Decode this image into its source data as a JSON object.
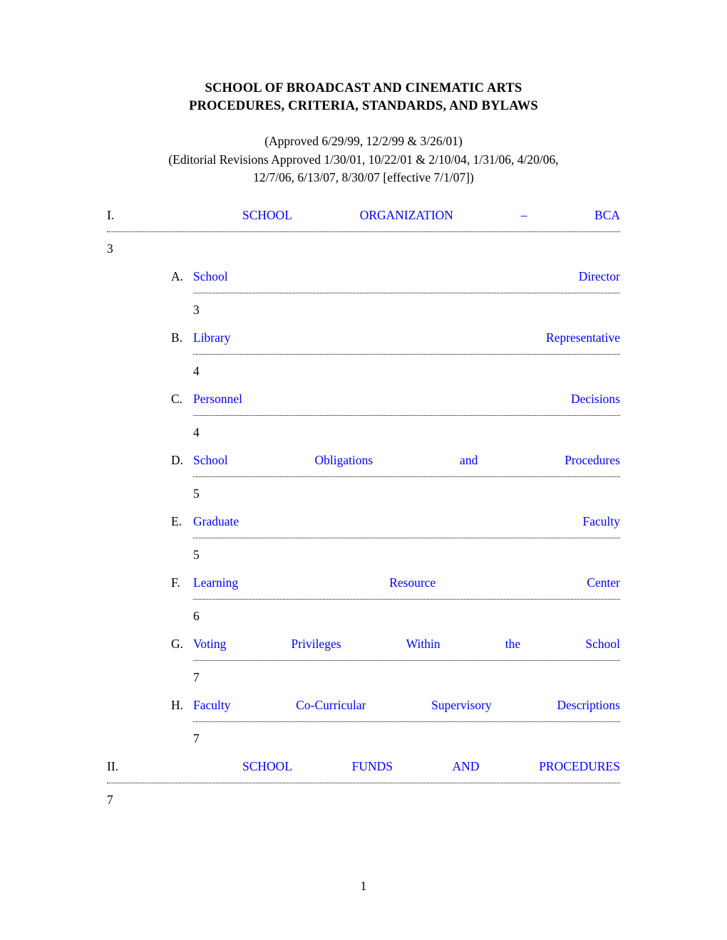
{
  "document": {
    "title_lines": [
      "SCHOOL OF BROADCAST AND CINEMATIC ARTS",
      "PROCEDURES, CRITERIA, STANDARDS, AND BYLAWS"
    ],
    "subtitle_lines": [
      "(Approved 6/29/99, 12/2/99 & 3/26/01)",
      "(Editorial Revisions Approved 1/30/01, 10/22/01 & 2/10/04, 1/31/06, 4/20/06,",
      "12/7/06, 6/13/07, 8/30/07 [effective 7/1/07])"
    ],
    "link_color": "#0000ff",
    "text_color": "#000000",
    "footer_page_number": "1"
  },
  "toc": {
    "entries": [
      {
        "level": 1,
        "marker": "I.",
        "words": [
          "SCHOOL",
          "ORGANIZATION",
          "–",
          "BCA"
        ],
        "page": "3"
      },
      {
        "level": 2,
        "marker": "A.",
        "words": [
          "School",
          "Director"
        ],
        "page": "3"
      },
      {
        "level": 2,
        "marker": "B.",
        "words": [
          "Library",
          "Representative"
        ],
        "page": "4"
      },
      {
        "level": 2,
        "marker": "C.",
        "words": [
          "Personnel",
          "Decisions"
        ],
        "page": "4"
      },
      {
        "level": 2,
        "marker": "D.",
        "words": [
          "School",
          "Obligations",
          "and",
          "Procedures"
        ],
        "page": "5"
      },
      {
        "level": 2,
        "marker": "E.",
        "words": [
          "Graduate",
          "Faculty"
        ],
        "page": "5"
      },
      {
        "level": 2,
        "marker": "F.",
        "words": [
          "Learning",
          "Resource",
          "Center"
        ],
        "page": "6"
      },
      {
        "level": 2,
        "marker": "G.",
        "words": [
          "Voting",
          "Privileges",
          "Within",
          "the",
          "School"
        ],
        "page": "7"
      },
      {
        "level": 2,
        "marker": "H.",
        "words": [
          "Faculty",
          "Co-Curricular",
          "Supervisory",
          "Descriptions"
        ],
        "page": "7"
      },
      {
        "level": 1,
        "marker": "II.",
        "words": [
          "SCHOOL",
          "FUNDS",
          "AND",
          "PROCEDURES"
        ],
        "page": "7"
      }
    ]
  }
}
